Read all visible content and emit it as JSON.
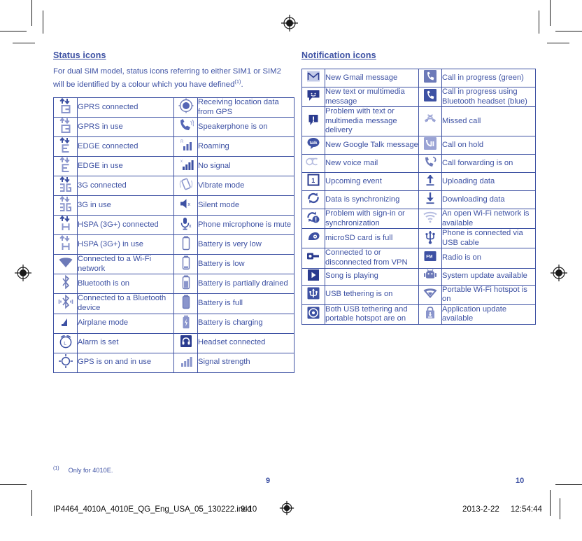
{
  "document": {
    "left_page": {
      "heading": "Status icons",
      "intro": "For dual SIM model, status icons referring to either SIM1 or SIM2 will be identified by a colour which you have defined",
      "intro_footnote_marker": "(1)",
      "intro_trailing": ".",
      "folio": "9",
      "rows": [
        {
          "left_icon": "gprs-connected-icon",
          "left_label": "GPRS connected",
          "right_icon": "gps-receiving-icon",
          "right_label": "Receiving location data from GPS"
        },
        {
          "left_icon": "gprs-in-use-icon",
          "left_label": "GPRS in use",
          "right_icon": "speakerphone-icon",
          "right_label": "Speakerphone is on"
        },
        {
          "left_icon": "edge-connected-icon",
          "left_label": "EDGE connected",
          "right_icon": "roaming-icon",
          "right_label": "Roaming"
        },
        {
          "left_icon": "edge-in-use-icon",
          "left_label": "EDGE in use",
          "right_icon": "no-signal-icon",
          "right_label": "No signal"
        },
        {
          "left_icon": "3g-connected-icon",
          "left_label": "3G connected",
          "right_icon": "vibrate-mode-icon",
          "right_label": "Vibrate mode"
        },
        {
          "left_icon": "3g-in-use-icon",
          "left_label": "3G in use",
          "right_icon": "silent-mode-icon",
          "right_label": "Silent mode"
        },
        {
          "left_icon": "hspa-connected-icon",
          "left_label": "HSPA (3G+) connected",
          "right_icon": "microphone-mute-icon",
          "right_label": "Phone microphone is mute"
        },
        {
          "left_icon": "hspa-in-use-icon",
          "left_label": "HSPA (3G+) in use",
          "right_icon": "battery-very-low-icon",
          "right_label": "Battery is very low"
        },
        {
          "left_icon": "wifi-connected-icon",
          "left_label": "Connected to a Wi-Fi network",
          "right_icon": "battery-low-icon",
          "right_label": "Battery is low"
        },
        {
          "left_icon": "bluetooth-on-icon",
          "left_label": "Bluetooth is on",
          "right_icon": "battery-partial-icon",
          "right_label": "Battery is partially drained"
        },
        {
          "left_icon": "bluetooth-connected-icon",
          "left_label": "Connected to a Bluetooth device",
          "right_icon": "battery-full-icon",
          "right_label": "Battery is full"
        },
        {
          "left_icon": "airplane-mode-icon",
          "left_label": "Airplane mode",
          "right_icon": "battery-charging-icon",
          "right_label": "Battery is charging"
        },
        {
          "left_icon": "alarm-icon",
          "left_label": "Alarm is set",
          "right_icon": "headset-icon",
          "right_label": "Headset connected"
        },
        {
          "left_icon": "gps-active-icon",
          "left_label": "GPS is on and in use",
          "right_icon": "signal-strength-icon",
          "right_label": "Signal strength"
        }
      ]
    },
    "right_page": {
      "heading": "Notification icons",
      "folio": "10",
      "rows": [
        {
          "left_icon": "gmail-icon",
          "left_label": "New Gmail message",
          "right_icon": "call-in-progress-icon",
          "right_label": "Call in progress (green)"
        },
        {
          "left_icon": "sms-message-icon",
          "left_label": "New text or multimedia message",
          "right_icon": "call-bluetooth-icon",
          "right_label": "Call in progress using Bluetooth headset (blue)"
        },
        {
          "left_icon": "message-problem-icon",
          "left_label": "Problem with text or multimedia message delivery",
          "right_icon": "missed-call-icon",
          "right_label": "Missed call"
        },
        {
          "left_icon": "google-talk-icon",
          "left_label": "New Google Talk message",
          "right_icon": "call-on-hold-icon",
          "right_label": "Call on hold"
        },
        {
          "left_icon": "voicemail-icon",
          "left_label": "New voice mail",
          "right_icon": "call-forwarding-icon",
          "right_label": "Call forwarding is on"
        },
        {
          "left_icon": "calendar-event-icon",
          "left_label": "Upcoming event",
          "right_icon": "upload-icon",
          "right_label": "Uploading data"
        },
        {
          "left_icon": "sync-icon",
          "left_label": "Data is synchronizing",
          "right_icon": "download-icon",
          "right_label": "Downloading data"
        },
        {
          "left_icon": "sync-problem-icon",
          "left_label": "Problem with sign-in or synchronization",
          "right_icon": "open-wifi-icon",
          "right_label": "An open Wi-Fi network is available"
        },
        {
          "left_icon": "microsd-full-icon",
          "left_label": "microSD card is full",
          "right_icon": "usb-cable-icon",
          "right_label": "Phone is connected via USB cable"
        },
        {
          "left_icon": "vpn-icon",
          "left_label": "Connected to or disconnected from VPN",
          "right_icon": "fm-radio-icon",
          "right_label": "Radio is on"
        },
        {
          "left_icon": "music-playing-icon",
          "left_label": "Song is playing",
          "right_icon": "android-update-icon",
          "right_label": "System update available"
        },
        {
          "left_icon": "usb-tethering-icon",
          "left_label": "USB tethering is on",
          "right_icon": "wifi-hotspot-icon",
          "right_label": "Portable Wi-Fi hotspot is on"
        },
        {
          "left_icon": "tethering-and-hotspot-icon",
          "left_label": "Both USB tethering and portable hotspot are on",
          "right_icon": "app-update-icon",
          "right_label": "Application update available"
        }
      ]
    },
    "footnote": {
      "marker": "(1)",
      "text": "Only for 4010E."
    },
    "slugline": {
      "filename": "IP4464_4010A_4010E_QG_Eng_USA_05_130222.indd",
      "page_range": "9-10",
      "date": "2013-2-22",
      "time": "12:54:44"
    },
    "colors": {
      "ink_blue": "#3d51a3",
      "icon_light": "#8a95cc",
      "icon_mid": "#6d7ab8",
      "rule": "#3d51a3",
      "crop_mark": "#1a1a1a"
    }
  }
}
